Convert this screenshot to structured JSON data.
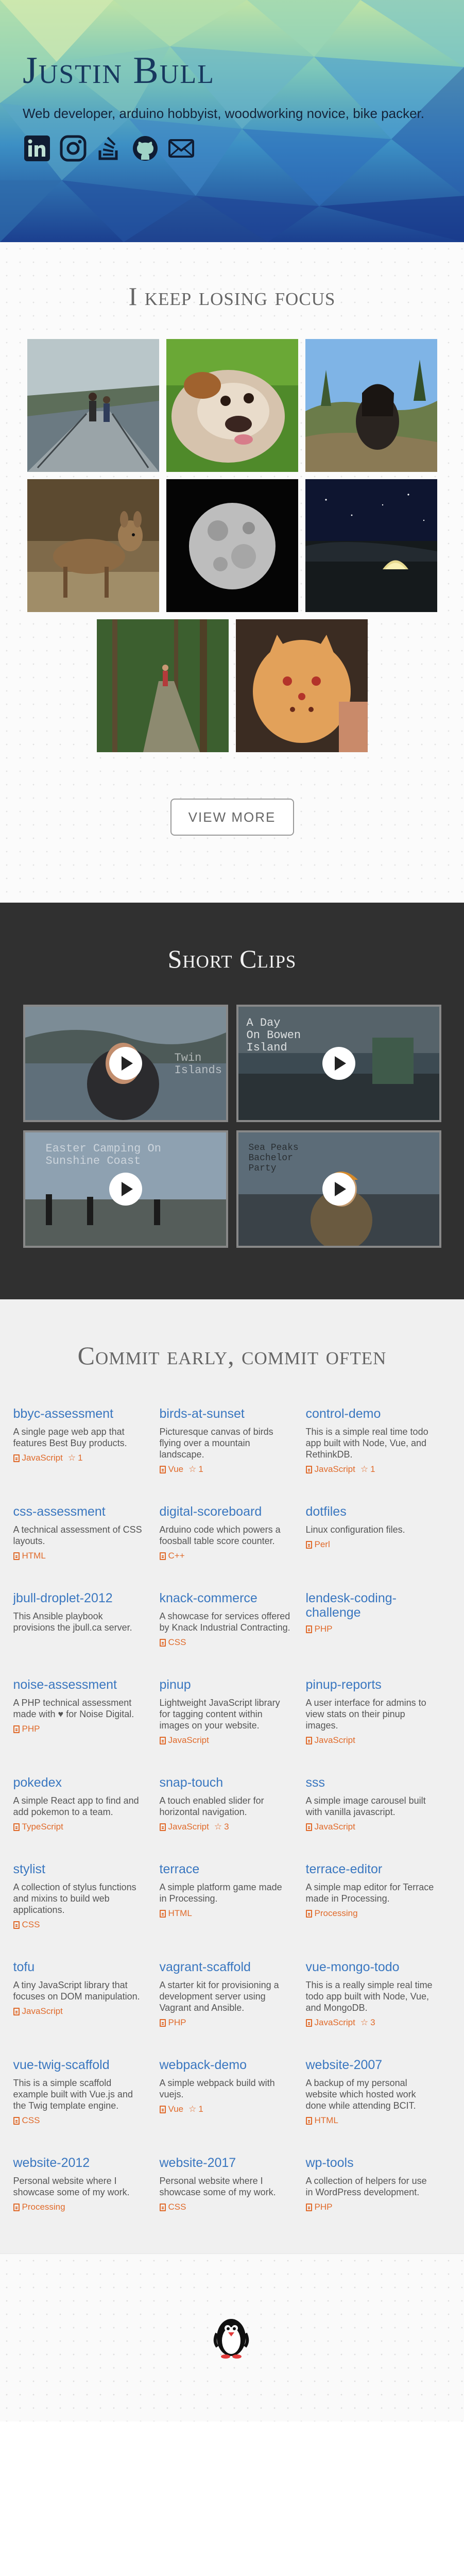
{
  "header": {
    "name": "Justin Bull",
    "tagline": "Web developer, arduino hobbyist, woodworking novice, bike packer.",
    "socials": [
      {
        "name": "linkedin-icon"
      },
      {
        "name": "instagram-icon"
      },
      {
        "name": "stackoverflow-icon"
      },
      {
        "name": "github-icon"
      },
      {
        "name": "email-icon"
      }
    ]
  },
  "photos": {
    "title": "I keep losing focus",
    "view_more": "VIEW MORE",
    "items": [
      "bridge-walk-photo",
      "bulldog-photo",
      "woman-in-hills-photo",
      "deer-photo",
      "moon-photo",
      "night-tent-photo",
      "forest-trail-photo",
      "cat-cookie-photo"
    ]
  },
  "clips": {
    "title": "Short Clips",
    "items": [
      {
        "overlay": "Twin\nIslands"
      },
      {
        "overlay": "A Day\nOn Bowen\nIsland"
      },
      {
        "overlay": "Easter Camping On\nSunshine Coast"
      },
      {
        "overlay": "Sea Peaks\nBachelor\nParty"
      }
    ]
  },
  "repos": {
    "title": "Commit early, commit often",
    "items": [
      {
        "name": "bbyc-assessment",
        "desc": "A single page web app that features Best Buy products.",
        "lang": "JavaScript",
        "stars": "1"
      },
      {
        "name": "birds-at-sunset",
        "desc": "Picturesque canvas of birds flying over a mountain landscape.",
        "lang": "Vue",
        "stars": "1"
      },
      {
        "name": "control-demo",
        "desc": "This is a simple real time todo app built with Node, Vue, and RethinkDB.",
        "lang": "JavaScript",
        "stars": "1"
      },
      {
        "name": "css-assessment",
        "desc": "A technical assessment of CSS layouts.",
        "lang": "HTML",
        "stars": ""
      },
      {
        "name": "digital-scoreboard",
        "desc": "Arduino code which powers a foosball table score counter.",
        "lang": "C++",
        "stars": ""
      },
      {
        "name": "dotfiles",
        "desc": "Linux configuration files.",
        "lang": "Perl",
        "stars": ""
      },
      {
        "name": "jbull-droplet-2012",
        "desc": "This Ansible playbook provisions the jbull.ca server.",
        "lang": "",
        "stars": ""
      },
      {
        "name": "knack-commerce",
        "desc": "A showcase for services offered by Knack Industrial Contracting.",
        "lang": "CSS",
        "stars": ""
      },
      {
        "name": "lendesk-coding-challenge",
        "desc": "",
        "lang": "PHP",
        "stars": ""
      },
      {
        "name": "noise-assessment",
        "desc": "A PHP technical assessment made with ♥ for Noise Digital.",
        "lang": "PHP",
        "stars": ""
      },
      {
        "name": "pinup",
        "desc": "Lightweight JavaScript library for tagging content within images on your website.",
        "lang": "JavaScript",
        "stars": ""
      },
      {
        "name": "pinup-reports",
        "desc": "A user interface for admins to view stats on their pinup images.",
        "lang": "JavaScript",
        "stars": ""
      },
      {
        "name": "pokedex",
        "desc": "A simple React app to find and add pokemon to a team.",
        "lang": "TypeScript",
        "stars": ""
      },
      {
        "name": "snap-touch",
        "desc": "A touch enabled slider for horizontal navigation.",
        "lang": "JavaScript",
        "stars": "3"
      },
      {
        "name": "sss",
        "desc": "A simple image carousel built with vanilla javascript.",
        "lang": "JavaScript",
        "stars": ""
      },
      {
        "name": "stylist",
        "desc": "A collection of stylus functions and mixins to build web applications.",
        "lang": "CSS",
        "stars": ""
      },
      {
        "name": "terrace",
        "desc": "A simple platform game made in Processing.",
        "lang": "HTML",
        "stars": ""
      },
      {
        "name": "terrace-editor",
        "desc": "A simple map editor for Terrace made in Processing.",
        "lang": "Processing",
        "stars": ""
      },
      {
        "name": "tofu",
        "desc": "A tiny JavaScript library that focuses on DOM manipulation.",
        "lang": "JavaScript",
        "stars": ""
      },
      {
        "name": "vagrant-scaffold",
        "desc": "A starter kit for provisioning a development server using Vagrant and Ansible.",
        "lang": "PHP",
        "stars": ""
      },
      {
        "name": "vue-mongo-todo",
        "desc": "This is a really simple real time todo app built with Node, Vue, and MongoDB.",
        "lang": "JavaScript",
        "stars": "3"
      },
      {
        "name": "vue-twig-scaffold",
        "desc": "This is a simple scaffold example built with Vue.js and the Twig template engine.",
        "lang": "CSS",
        "stars": ""
      },
      {
        "name": "webpack-demo",
        "desc": "A simple webpack build with vuejs.",
        "lang": "Vue",
        "stars": "1"
      },
      {
        "name": "website-2007",
        "desc": "A backup of my personal website which hosted work done while attending BCIT.",
        "lang": "HTML",
        "stars": ""
      },
      {
        "name": "website-2012",
        "desc": "Personal website where I showcase some of my work.",
        "lang": "Processing",
        "stars": ""
      },
      {
        "name": "website-2017",
        "desc": "Personal website where I showcase some of my work.",
        "lang": "CSS",
        "stars": ""
      },
      {
        "name": "wp-tools",
        "desc": "A collection of helpers for use in WordPress development.",
        "lang": "PHP",
        "stars": ""
      }
    ]
  },
  "footer": {
    "mascot": "penguin-icon"
  },
  "colors": {
    "link": "#3a77c0",
    "accent": "#e06a2a",
    "dark_section": "#303030",
    "header_title": "#17385e"
  }
}
